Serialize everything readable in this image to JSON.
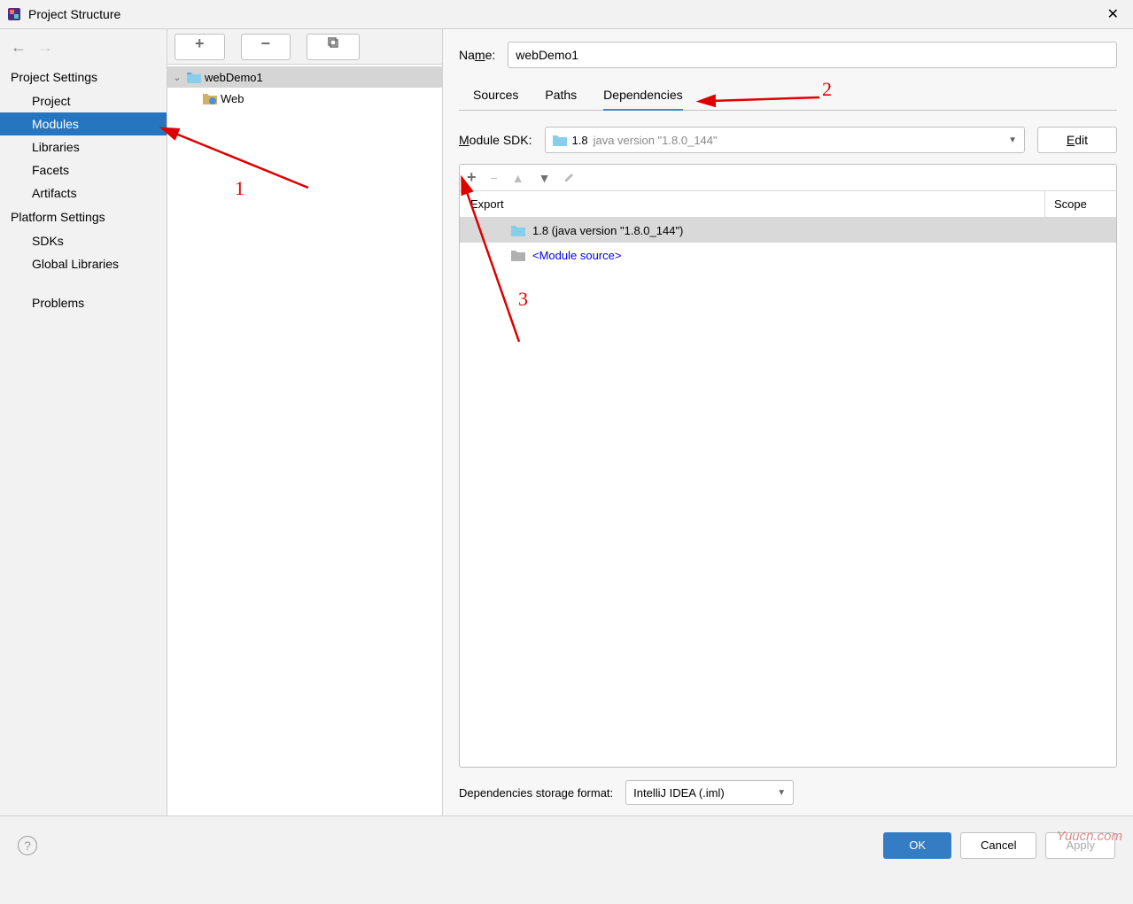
{
  "window": {
    "title": "Project Structure"
  },
  "sidebar": {
    "sections": [
      {
        "label": "Project Settings",
        "items": [
          "Project",
          "Modules",
          "Libraries",
          "Facets",
          "Artifacts"
        ],
        "selected": "Modules"
      },
      {
        "label": "Platform Settings",
        "items": [
          "SDKs",
          "Global Libraries"
        ]
      },
      {
        "label_blank": "",
        "items": [
          "Problems"
        ]
      }
    ]
  },
  "tree": {
    "root": {
      "label": "webDemo1",
      "children": [
        {
          "label": "Web"
        }
      ]
    }
  },
  "detail": {
    "name_label": "Name:",
    "name_value": "webDemo1",
    "tabs": [
      "Sources",
      "Paths",
      "Dependencies"
    ],
    "active_tab": "Dependencies",
    "sdk_label": "Module SDK:",
    "sdk_value": "1.8",
    "sdk_desc": "java version \"1.8.0_144\"",
    "edit_label": "Edit",
    "dep_header": {
      "export": "Export",
      "scope": "Scope"
    },
    "deps": [
      {
        "label": "1.8 (java version \"1.8.0_144\")",
        "selected": true
      },
      {
        "label": "<Module source>",
        "link": true
      }
    ],
    "storage_label": "Dependencies storage format:",
    "storage_value": "IntelliJ IDEA (.iml)"
  },
  "footer": {
    "ok": "OK",
    "cancel": "Cancel",
    "apply": "Apply"
  },
  "annotations": {
    "a1": "1",
    "a2": "2",
    "a3": "3"
  },
  "watermark": "Yuucn.com"
}
